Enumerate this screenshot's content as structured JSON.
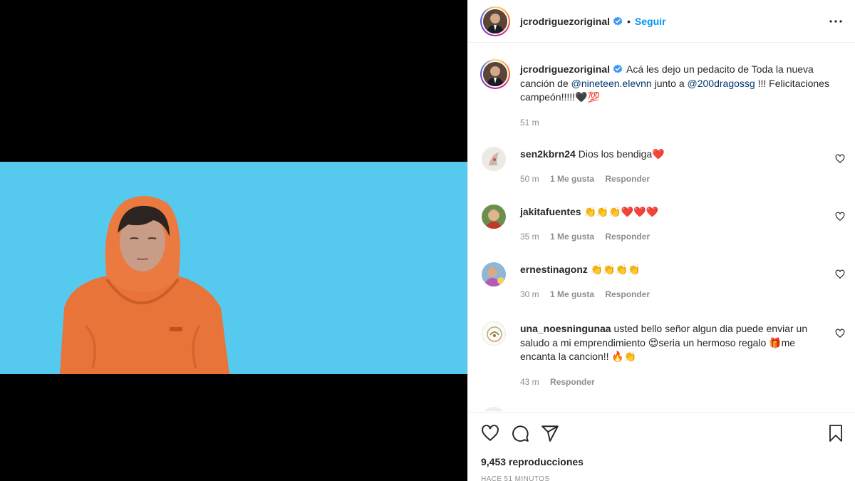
{
  "header": {
    "username": "jcrodriguezoriginal",
    "separator": "•",
    "follow_label": "Seguir"
  },
  "caption": {
    "username": "jcrodriguezoriginal",
    "part1": "Acá les dejo un pedacito de Toda la nueva canción de ",
    "mention1": "@nineteen.elevnn",
    "part2": " junto a ",
    "mention2": "@200dragossg",
    "part3": " !!! Felicitaciones campeón!!!!!🖤💯",
    "time": "51 m"
  },
  "comments": [
    {
      "username": "sen2kbrn24",
      "text": "Dios los bendiga❤️",
      "time": "50 m",
      "likes": "1 Me gusta",
      "reply": "Responder"
    },
    {
      "username": "jakitafuentes",
      "text": "👏👏👏❤️❤️❤️",
      "time": "35 m",
      "likes": "1 Me gusta",
      "reply": "Responder"
    },
    {
      "username": "ernestinagonz",
      "text": "👏👏👏👏",
      "time": "30 m",
      "likes": "1 Me gusta",
      "reply": "Responder"
    },
    {
      "username": "una_noesningunaa",
      "text": "usted bello señor algun dia puede enviar un saludo a mi emprendimiento 😍seria un hermoso regalo 🎁me encanta la cancion!! 🔥👏",
      "time": "43 m",
      "reply": "Responder"
    }
  ],
  "footer": {
    "views": "9,453 reproducciones",
    "ago": "HACE 51 MINUTOS"
  },
  "icons": {
    "like": "heart-icon",
    "comment": "comment-icon",
    "share": "send-icon",
    "save": "bookmark-icon",
    "more": "more-icon",
    "verified": "verified-badge-icon"
  },
  "colors": {
    "accent": "#0095f6",
    "mention": "#00376b",
    "muted": "#8e8e8e",
    "video_bg": "#56c9ee",
    "hoodie": "#e8743a",
    "verified": "#3897f0"
  }
}
